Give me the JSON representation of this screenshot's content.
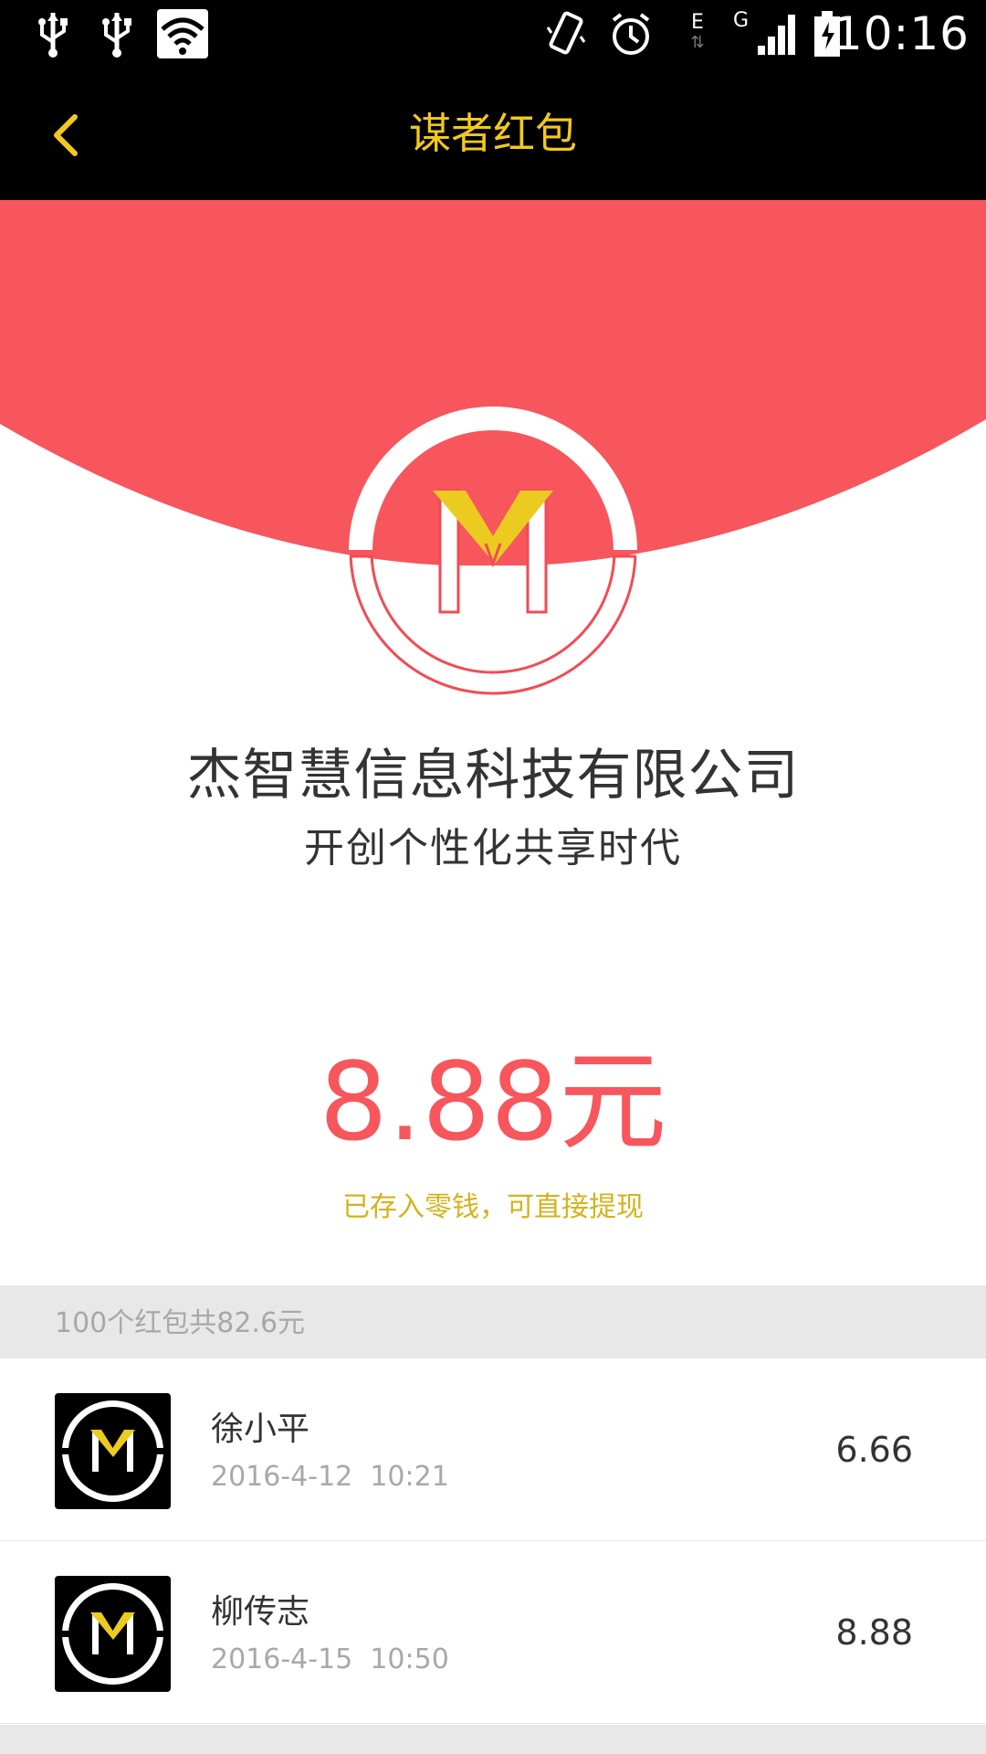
{
  "status_bar": {
    "time": "10:16",
    "icons": [
      "usb-icon",
      "usb-icon",
      "wifi-icon",
      "vibrate-icon",
      "alarm-icon",
      "edge-data-icon",
      "signal-icon",
      "battery-icon"
    ],
    "network_label_e": "E",
    "network_label_g": "G"
  },
  "navbar": {
    "title": "谋者红包",
    "back_icon": "chevron-left-icon",
    "accent": "#f2c81e"
  },
  "hero": {
    "background": "#f7565d",
    "logo_letter": "M"
  },
  "company": {
    "name": "杰智慧信息科技有限公司",
    "slogan": "开创个性化共享时代"
  },
  "envelope": {
    "amount": "8.88元",
    "note": "已存入零钱，可直接提现",
    "amount_color": "#f7565d",
    "note_color": "#d4b21d"
  },
  "summary": {
    "text": "100个红包共82.6元"
  },
  "records": [
    {
      "name": "徐小平",
      "time": "2016-4-12  10:21",
      "amount": "6.66",
      "avatar_letter": "M"
    },
    {
      "name": "柳传志",
      "time": "2016-4-15  10:50",
      "amount": "8.88",
      "avatar_letter": "M"
    }
  ]
}
